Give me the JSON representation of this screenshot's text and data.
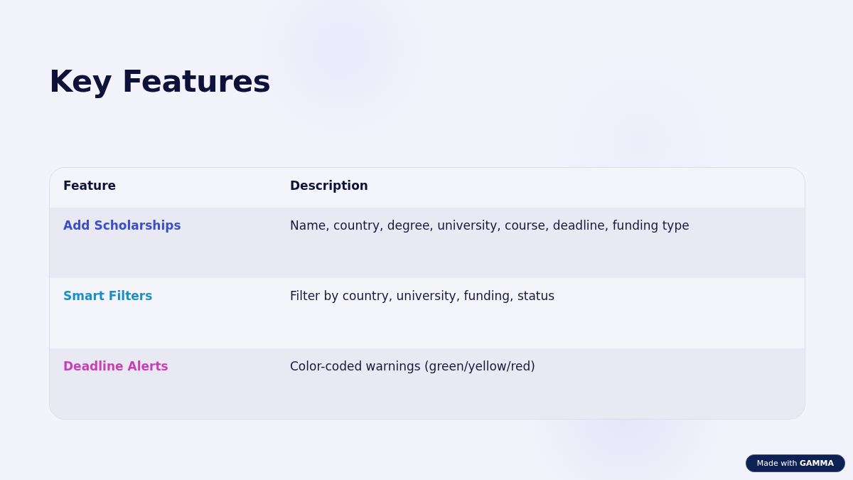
{
  "title": "Key Features",
  "table": {
    "columns": [
      "Feature",
      "Description"
    ],
    "rows": [
      {
        "feature": "Add Scholarships",
        "color": "#3a4fc8",
        "description": "Name, country, degree, university, course, deadline, funding type"
      },
      {
        "feature": "Smart Filters",
        "color": "#1b8fc4",
        "description": "Filter by country, university, funding, status"
      },
      {
        "feature": "Deadline Alerts",
        "color": "#c840b8",
        "description": "Color-coded warnings (green/yellow/red)"
      }
    ]
  },
  "badge": "Made with **GAMMA**"
}
